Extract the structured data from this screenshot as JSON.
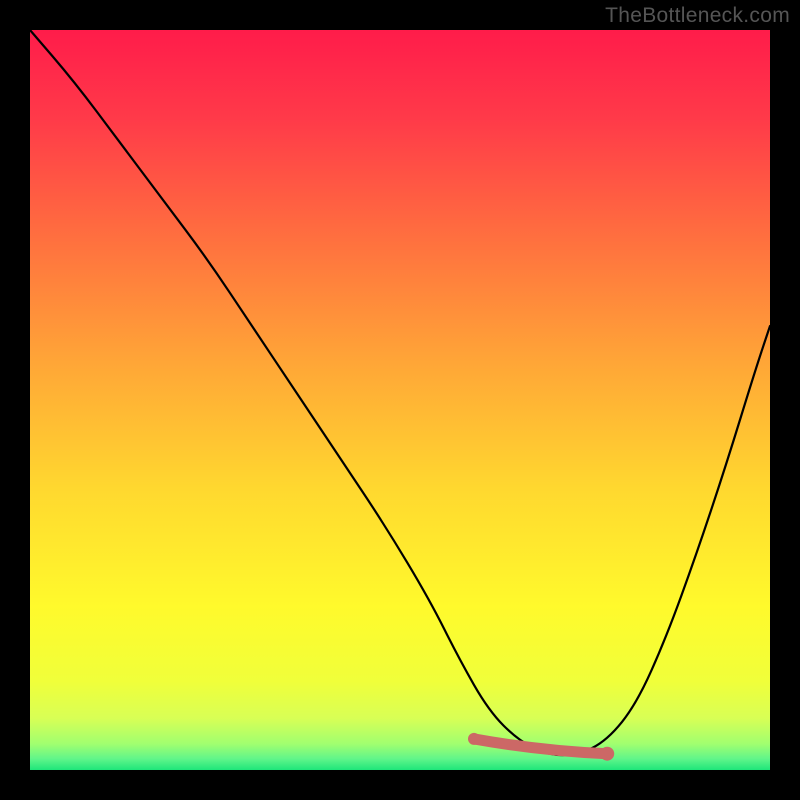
{
  "watermark": "TheBottleneck.com",
  "colors": {
    "background": "#000000",
    "curve_stroke": "#000000",
    "marker_stroke": "#cc6866",
    "gradient_stops": [
      {
        "offset": 0.0,
        "color": "#ff1c4a"
      },
      {
        "offset": 0.12,
        "color": "#ff3a49"
      },
      {
        "offset": 0.28,
        "color": "#ff6f3f"
      },
      {
        "offset": 0.45,
        "color": "#ffa637"
      },
      {
        "offset": 0.62,
        "color": "#ffd82f"
      },
      {
        "offset": 0.78,
        "color": "#fffa2c"
      },
      {
        "offset": 0.88,
        "color": "#f0ff3a"
      },
      {
        "offset": 0.93,
        "color": "#d8ff55"
      },
      {
        "offset": 0.965,
        "color": "#a0ff70"
      },
      {
        "offset": 0.985,
        "color": "#60f58a"
      },
      {
        "offset": 1.0,
        "color": "#1ee67a"
      }
    ]
  },
  "chart_data": {
    "type": "line",
    "title": "",
    "xlabel": "",
    "ylabel": "",
    "xlim": [
      0,
      100
    ],
    "ylim": [
      0,
      100
    ],
    "series": [
      {
        "name": "bottleneck-curve",
        "x": [
          0,
          6,
          12,
          18,
          24,
          30,
          36,
          42,
          48,
          54,
          58,
          62,
          66,
          70,
          74,
          78,
          82,
          86,
          90,
          94,
          98,
          100
        ],
        "values": [
          100,
          93,
          85,
          77,
          69,
          60,
          51,
          42,
          33,
          23,
          15,
          8,
          4,
          2,
          2,
          4,
          9,
          18,
          29,
          41,
          54,
          60
        ]
      }
    ],
    "optimal_marker": {
      "x_start": 60,
      "x_end": 78,
      "y": 3
    }
  }
}
